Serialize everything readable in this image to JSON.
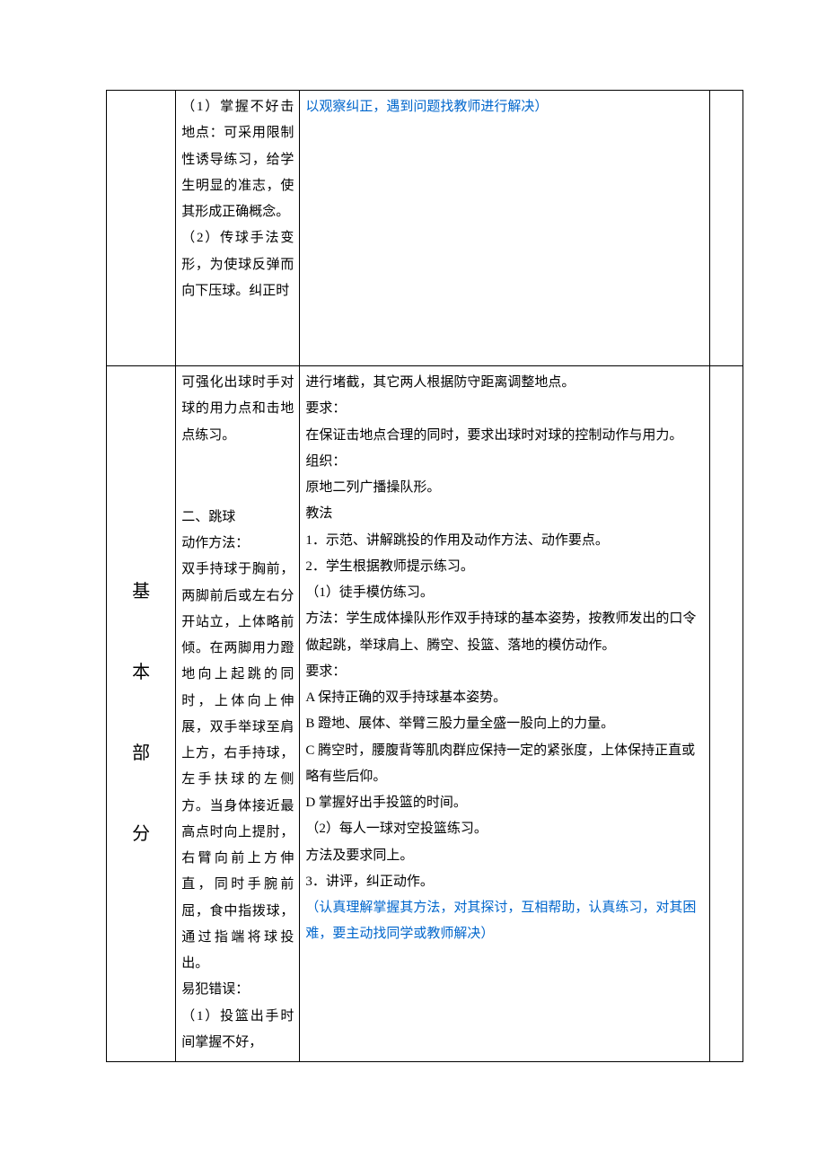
{
  "row1": {
    "method": "（1）掌握不好击地点：可采用限制性诱导练习，给学生明显的准志，使其形成正确概念。\n（2）传球手法变形，为使球反弹而向下压球。纠正时",
    "content_blue": "以观察纠正，遇到问题找教师进行解决）"
  },
  "row2": {
    "section": "基\n本\n部\n分",
    "method_a": "可强化出球时手对球的用力点和击地点练习。",
    "method_b": "二、跳球\n动作方法：\n双手持球于胸前，两脚前后或左右分开站立，上体略前倾。在两脚用力蹬地向上起跳的同时，上体向上伸展，双手举球至肩上方，右手持球，左手扶球的左侧方。当身体接近最高点时向上提肘，右臂向前上方伸直，同时手腕前屈，食中指拨球，通过指端将球投出。\n易犯错误：\n（1）投篮出手时间掌握不好，",
    "content_black_a": "进行堵截，其它两人根据防守距离调整地点。\n要求：\n在保证击地点合理的同时，要求出球时对球的控制动作与用力。\n组织：\n原地二列广播操队形。\n教法\n1．示范、讲解跳投的作用及动作方法、动作要点。\n2．学生根据教师提示练习。\n（1）徒手模仿练习。\n方法：学生成体操队形作双手持球的基本姿势，按教师发出的口令做起跳，举球肩上、腾空、投篮、落地的模仿动作。\n要求：\nA 保持正确的双手持球基本姿势。\nB 蹬地、展体、举臂三股力量全盛一股向上的力量。\nC 腾空时，腰腹背等肌肉群应保持一定的紧张度，上体保持正直或略有些后仰。\nD 掌握好出手投篮的时间。\n（2）每人一球对空投篮练习。\n方法及要求同上。\n3．讲评，纠正动作。",
    "content_blue_a": "（认真理解掌握其方法，对其探讨，互相帮助，认真练习，对其困难，要主动找同学或教师解决）"
  }
}
